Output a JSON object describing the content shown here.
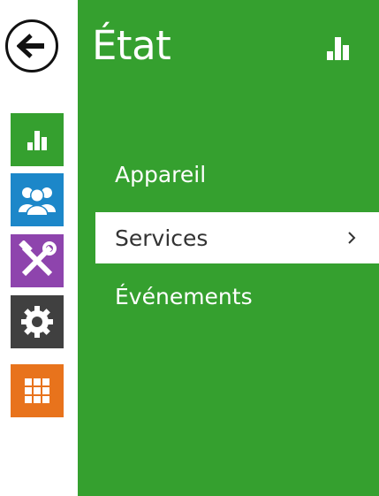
{
  "page": {
    "title": "État",
    "title_icon": "bar-chart-icon"
  },
  "rail": {
    "back_icon": "back-arrow-icon",
    "items": [
      {
        "icon": "bar-chart-icon",
        "color": "#35a02f",
        "selected": true
      },
      {
        "icon": "users-icon",
        "color": "#1c87c9"
      },
      {
        "icon": "tools-icon",
        "color": "#8e44ad"
      },
      {
        "icon": "gear-icon",
        "color": "#404040"
      },
      {
        "icon": "grid-icon",
        "color": "#e8731c"
      }
    ]
  },
  "menu": {
    "items": [
      {
        "label": "Appareil"
      },
      {
        "label": "Services",
        "active": true,
        "chevron_icon": "chevron-right-icon"
      },
      {
        "label": "Événements"
      }
    ]
  },
  "colors": {
    "panel": "#35a02f",
    "active_text": "#333333"
  }
}
